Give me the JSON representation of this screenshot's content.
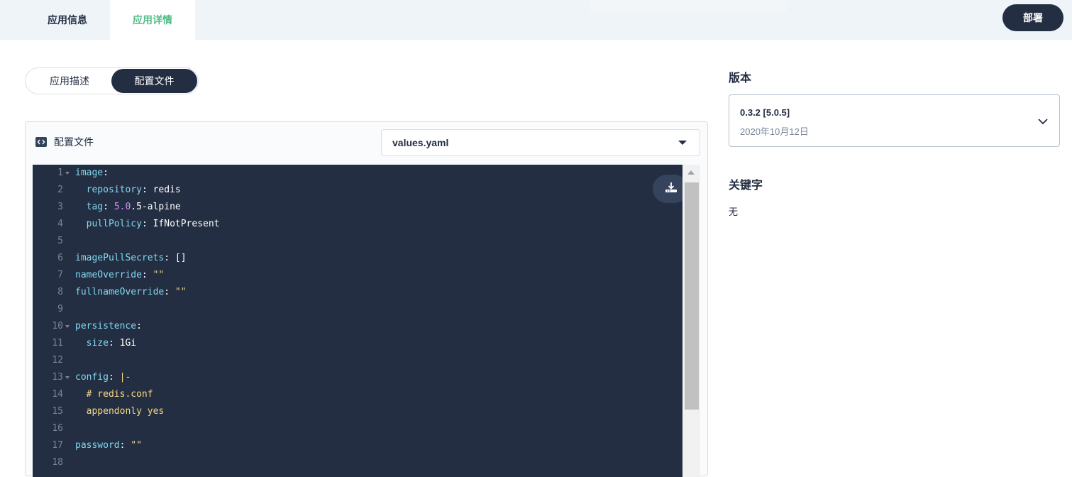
{
  "header": {
    "tabs": [
      {
        "label": "应用信息",
        "active": false
      },
      {
        "label": "应用详情",
        "active": true
      }
    ],
    "deploy_label": "部署"
  },
  "segment": {
    "items": [
      {
        "label": "应用描述",
        "active": false
      },
      {
        "label": "配置文件",
        "active": true
      }
    ]
  },
  "config_panel": {
    "title": "配置文件",
    "file_select_value": "values.yaml",
    "editor": {
      "lines": [
        {
          "n": "1",
          "text": "image:",
          "fold": true
        },
        {
          "n": "2",
          "text": "  repository: redis",
          "fold": false
        },
        {
          "n": "3",
          "text": "  tag: 5.0.5-alpine",
          "fold": false
        },
        {
          "n": "4",
          "text": "  pullPolicy: IfNotPresent",
          "fold": false
        },
        {
          "n": "5",
          "text": "",
          "fold": false
        },
        {
          "n": "6",
          "text": "imagePullSecrets: []",
          "fold": false
        },
        {
          "n": "7",
          "text": "nameOverride: \"\"",
          "fold": false
        },
        {
          "n": "8",
          "text": "fullnameOverride: \"\"",
          "fold": false
        },
        {
          "n": "9",
          "text": "",
          "fold": false
        },
        {
          "n": "10",
          "text": "persistence:",
          "fold": true
        },
        {
          "n": "11",
          "text": "  size: 1Gi",
          "fold": false
        },
        {
          "n": "12",
          "text": "",
          "fold": false
        },
        {
          "n": "13",
          "text": "config: |-",
          "fold": true
        },
        {
          "n": "14",
          "text": "  # redis.conf",
          "fold": false
        },
        {
          "n": "15",
          "text": "  appendonly yes",
          "fold": false
        },
        {
          "n": "16",
          "text": "",
          "fold": false
        },
        {
          "n": "17",
          "text": "password: \"\"",
          "fold": false
        },
        {
          "n": "18",
          "text": "",
          "fold": false
        }
      ]
    }
  },
  "sidebar": {
    "version_title": "版本",
    "version_value": "0.3.2 [5.0.5]",
    "version_date": "2020年10月12日",
    "keywords_title": "关键字",
    "keywords_value": "无"
  },
  "colors": {
    "primary_dark": "#242e42",
    "accent_green": "#55bc8a",
    "editor_bg": "#242e42",
    "yaml_key": "#81d9f0",
    "yaml_string": "#f6d985",
    "yaml_number": "#c88ff2"
  },
  "icons": [
    "file-code-icon",
    "caret-down-icon",
    "download-icon",
    "chevron-down-icon",
    "fold-arrow-icon",
    "scroll-up-arrow-icon"
  ]
}
